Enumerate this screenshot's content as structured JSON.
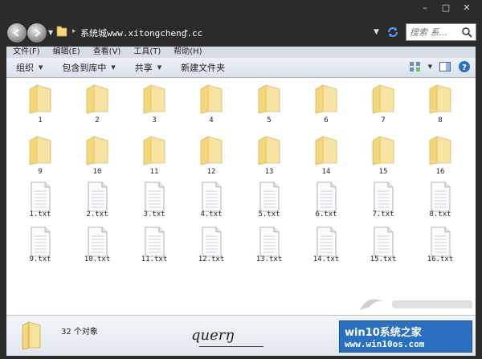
{
  "window": {
    "caption_min": "–",
    "caption_max": "□",
    "caption_close": "✕"
  },
  "address": {
    "path": "系统城www.xitongcheng.cc",
    "separator": "▸",
    "search_placeholder": "搜索 系..."
  },
  "menu": {
    "items": [
      "文件(F)",
      "编辑(E)",
      "查看(V)",
      "工具(T)",
      "帮助(H)"
    ]
  },
  "toolbar": {
    "buttons": [
      {
        "label": "组织",
        "has_caret": true
      },
      {
        "label": "包含到库中",
        "has_caret": true
      },
      {
        "label": "共享",
        "has_caret": true
      },
      {
        "label": "新建文件夹",
        "has_caret": false
      }
    ]
  },
  "items": {
    "folders": [
      "1",
      "2",
      "3",
      "4",
      "5",
      "6",
      "7",
      "8",
      "9",
      "10",
      "11",
      "12",
      "13",
      "14",
      "15",
      "16"
    ],
    "files": [
      "1.txt",
      "2.txt",
      "3.txt",
      "4.txt",
      "5.txt",
      "6.txt",
      "7.txt",
      "8.txt",
      "9.txt",
      "10.txt",
      "11.txt",
      "12.txt",
      "13.txt",
      "14.txt",
      "15.txt",
      "16.txt"
    ]
  },
  "details": {
    "count_text": "32 个对象",
    "signature": "querŋ"
  },
  "brand": {
    "line1": "win10系统之家",
    "line2": "www.win10os.com"
  },
  "colors": {
    "frame": "#2b2b2b",
    "menubar": "#d7dde6",
    "folder": "#f3d77a",
    "brand": "#2a6fc0"
  }
}
